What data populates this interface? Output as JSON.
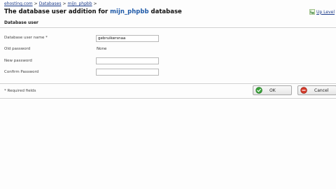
{
  "breadcrumb": {
    "items": [
      "ehosting.com",
      "Databases",
      "mijn_phpbb"
    ],
    "separator": ">"
  },
  "header": {
    "title_prefix": "The database user addition for",
    "title_db": "mijn_phpbb",
    "title_suffix": "database",
    "uplevel_label": "Up Level",
    "uplevel_icon": "up-level-arrow-icon"
  },
  "section": {
    "title": "Database user"
  },
  "form": {
    "username_label": "Database user name *",
    "username_value": "gebruikersnaa",
    "old_password_label": "Old password",
    "old_password_value": "None",
    "new_password_label": "New password",
    "new_password_value": "",
    "confirm_password_label": "Confirm Password",
    "confirm_password_value": ""
  },
  "footer": {
    "required_note": "* Required fields",
    "ok_label": "OK",
    "cancel_label": "Cancel"
  },
  "colors": {
    "link": "#1a3a8a",
    "db_name": "#1f5aa8",
    "ok_icon": "#3aa23a",
    "cancel_icon": "#d43a2a"
  }
}
